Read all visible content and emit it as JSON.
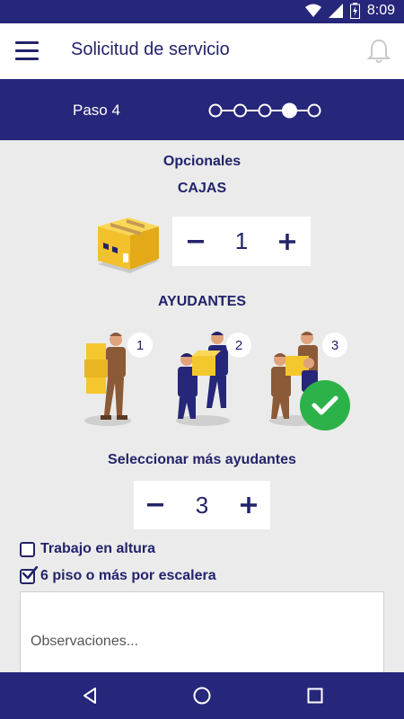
{
  "status_bar": {
    "time": "8:09",
    "icons": [
      "wifi-icon",
      "signal-icon",
      "battery-icon"
    ]
  },
  "app_bar": {
    "title": "Solicitud de servicio",
    "menu_icon": "hamburger-icon",
    "notification_icon": "bell-icon"
  },
  "steps": {
    "label": "Paso 4",
    "total": 5,
    "current": 4
  },
  "optionals": {
    "heading": "Opcionales",
    "boxes": {
      "heading": "CAJAS",
      "value": "1"
    },
    "helpers": {
      "heading": "AYUDANTES",
      "options": [
        {
          "number": "1",
          "selected": false
        },
        {
          "number": "2",
          "selected": false
        },
        {
          "number": "3",
          "selected": true
        }
      ]
    },
    "more_helpers": {
      "heading": "Seleccionar más ayudantes",
      "value": "3"
    }
  },
  "checkboxes": [
    {
      "label": "Trabajo en altura",
      "checked": false
    },
    {
      "label": "6 piso o más por escalera",
      "checked": true
    }
  ],
  "observations": {
    "placeholder": "Observaciones..."
  },
  "colors": {
    "primary": "#26267a",
    "text": "#23236b",
    "accent_box": "#f5c72e",
    "selected": "#2db24a",
    "background": "#ebebeb"
  },
  "nav_bar": {
    "icons": [
      "back-icon",
      "home-icon",
      "recents-icon"
    ]
  }
}
